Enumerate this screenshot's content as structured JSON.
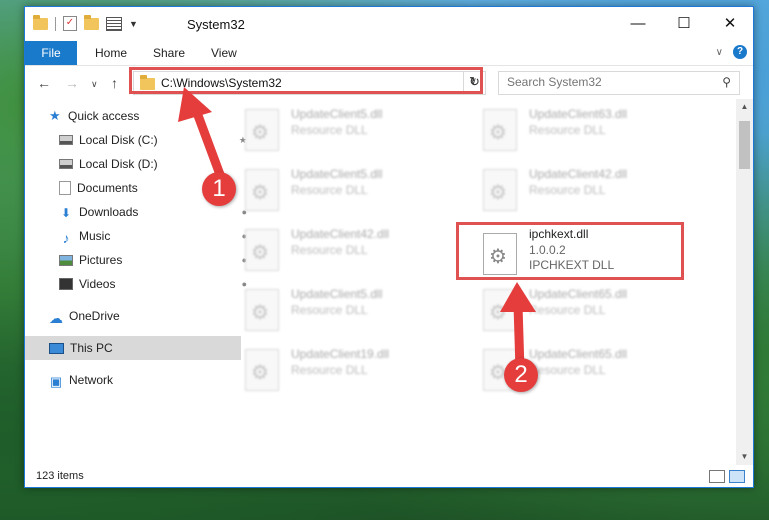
{
  "window": {
    "title": "System32"
  },
  "ribbon": {
    "file_tab": "File",
    "tabs": [
      "Home",
      "Share",
      "View"
    ]
  },
  "address": {
    "path": "C:\\Windows\\System32"
  },
  "search": {
    "placeholder": "Search System32"
  },
  "sidebar": {
    "items": [
      {
        "label": "Quick access",
        "icon": "star-icon"
      },
      {
        "label": "Local Disk (C:)",
        "icon": "drive-icon"
      },
      {
        "label": "Local Disk (D:)",
        "icon": "drive-icon"
      },
      {
        "label": "Documents",
        "icon": "documents-icon"
      },
      {
        "label": "Downloads",
        "icon": "download-icon"
      },
      {
        "label": "Music",
        "icon": "music-icon"
      },
      {
        "label": "Pictures",
        "icon": "pictures-icon"
      },
      {
        "label": "Videos",
        "icon": "videos-icon"
      },
      {
        "label": "OneDrive",
        "icon": "cloud-icon"
      },
      {
        "label": "This PC",
        "icon": "computer-icon",
        "selected": true
      },
      {
        "label": "Network",
        "icon": "network-icon"
      }
    ]
  },
  "files": [
    {
      "name": "UpdateClient5.dll",
      "type": "Resource DLL"
    },
    {
      "name": "UpdateClient63.dll",
      "type": "Resource DLL"
    },
    {
      "name": "UpdateClient5.dll",
      "type": "Resource DLL"
    },
    {
      "name": "UpdateClient42.dll",
      "type": "Resource DLL"
    },
    {
      "name": "UpdateClient42.dll",
      "type": "Resource DLL"
    },
    {
      "name": "ipchkext.dll",
      "version": "1.0.0.2",
      "type": "IPCHKEXT DLL"
    },
    {
      "name": "UpdateClient5.dll",
      "type": "Resource DLL"
    },
    {
      "name": "UpdateClient65.dll",
      "type": "Resource DLL"
    },
    {
      "name": "UpdateClient19.dll",
      "type": "Resource DLL"
    },
    {
      "name": "UpdateClient65.dll",
      "type": "Resource DLL"
    }
  ],
  "status": {
    "item_count": "123 items"
  },
  "annotations": {
    "step1": "1",
    "step2": "2",
    "color": "#e53c3c"
  }
}
